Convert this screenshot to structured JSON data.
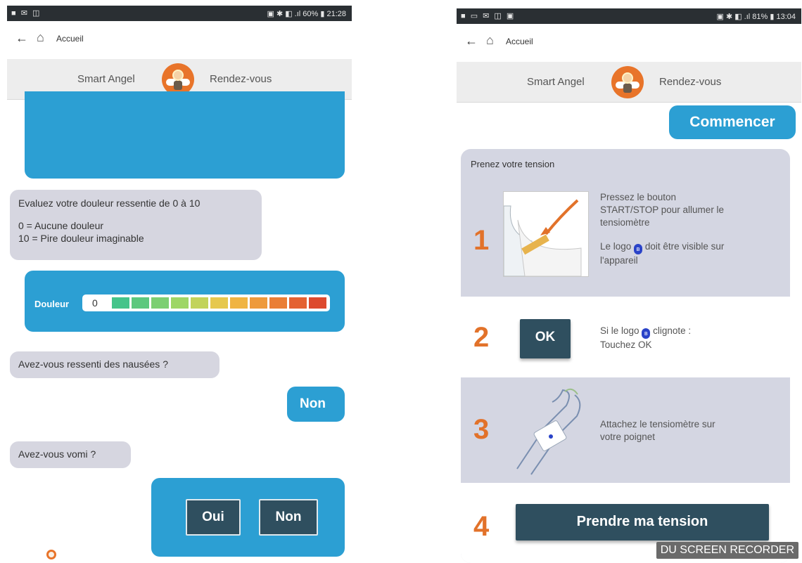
{
  "left_screen": {
    "status_bar": {
      "left_icons": "■ ✉ ◫",
      "right_text": "▣ ✱ ◧ .ıl 60% ▮ 21:28"
    },
    "nav": {
      "title": "Accueil"
    },
    "tabs": {
      "left": "Smart Angel",
      "right": "Rendez-vous"
    },
    "pain_question": {
      "line1": "Evaluez votre douleur ressentie de 0 à 10",
      "line2": "0 = Aucune douleur",
      "line3": "10 = Pire douleur imaginable"
    },
    "pain_scale": {
      "label": "Douleur",
      "value": "0",
      "segment_colors": [
        "#44c48a",
        "#5cc87e",
        "#7ccf72",
        "#9ed666",
        "#c2d35a",
        "#e6c84e",
        "#f0b442",
        "#ee9a3c",
        "#ea7e36",
        "#e46232",
        "#dd4a2e"
      ]
    },
    "nausea": {
      "question": "Avez-vous ressenti des nausées ?",
      "answer": "Non"
    },
    "vomit": {
      "question": "Avez-vous vomi ?",
      "yes": "Oui",
      "no": "Non"
    }
  },
  "right_screen": {
    "status_bar": {
      "left_icons": "■ ▭ ✉ ◫ ▣",
      "right_text": "▣ ✱ ◧ .ıl 81% ▮ 13:04"
    },
    "nav": {
      "title": "Accueil"
    },
    "tabs": {
      "left": "Smart Angel",
      "right": "Rendez-vous"
    },
    "start_button": "Commencer",
    "card": {
      "title": "Prenez votre tension",
      "steps": [
        {
          "number": "1",
          "line1": "Pressez le bouton",
          "line2": "START/STOP pour allumer le",
          "line3": "tensiomètre",
          "line4a": "Le logo",
          "line4b": "doit être visible sur",
          "line5": "l'appareil"
        },
        {
          "number": "2",
          "button": "OK",
          "line1a": "Si le logo",
          "line1b": "clignote :",
          "line2": "Touchez OK"
        },
        {
          "number": "3",
          "line1": "Attachez le tensiomètre sur",
          "line2": "votre poignet"
        },
        {
          "number": "4",
          "button": "Prendre ma tension"
        }
      ]
    },
    "watermark": "DU SCREEN RECORDER"
  },
  "colors": {
    "accent_blue": "#2c9fd3",
    "step_orange": "#e2722a",
    "dark_button": "#2f4f5f",
    "bubble_grey": "#d6d6e0"
  }
}
